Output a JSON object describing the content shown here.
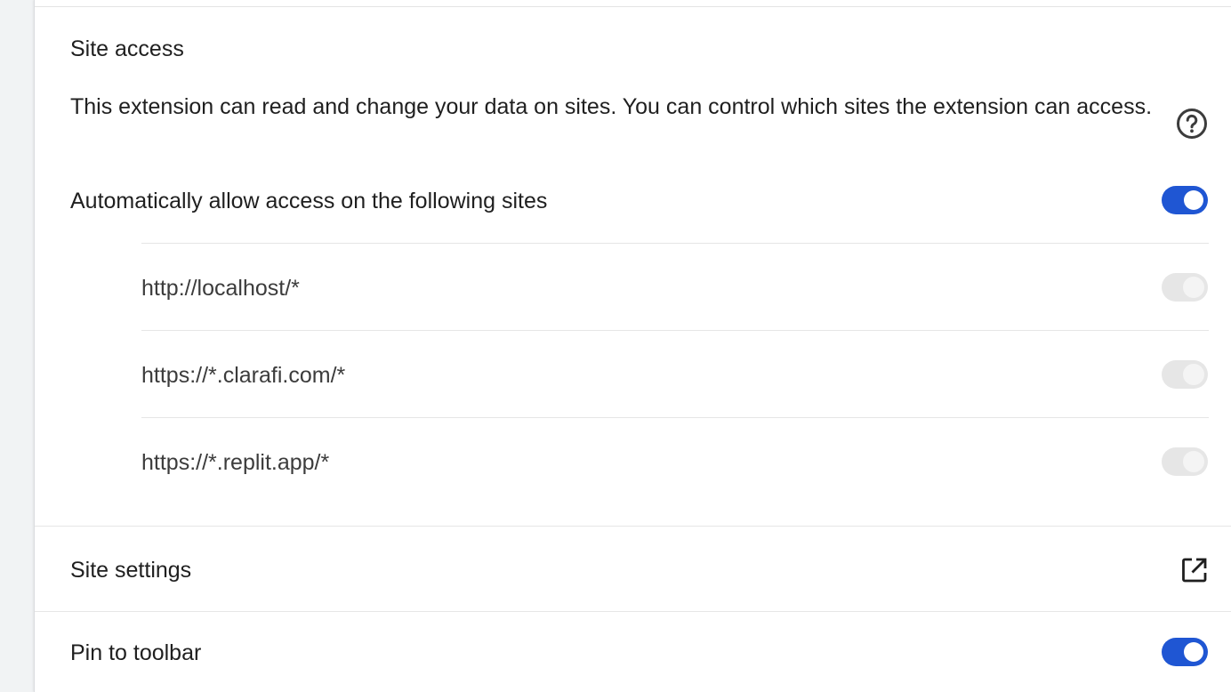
{
  "site_access": {
    "title": "Site access",
    "description": "This extension can read and change your data on sites. You can control which sites the extension can access.",
    "help_icon": "help-circle-icon",
    "auto_allow": {
      "label": "Automatically allow access on the following sites",
      "enabled": true
    },
    "sites": [
      {
        "url": "http://localhost/*",
        "enabled": false
      },
      {
        "url": "https://*.clarafi.com/*",
        "enabled": false
      },
      {
        "url": "https://*.replit.app/*",
        "enabled": false
      }
    ]
  },
  "site_settings": {
    "label": "Site settings",
    "icon": "open-in-new-icon"
  },
  "pin_to_toolbar": {
    "label": "Pin to toolbar",
    "enabled": true
  },
  "colors": {
    "toggle_on": "#1f56d3",
    "toggle_disabled": "#e6e6e6",
    "divider": "#e6e6e6"
  }
}
